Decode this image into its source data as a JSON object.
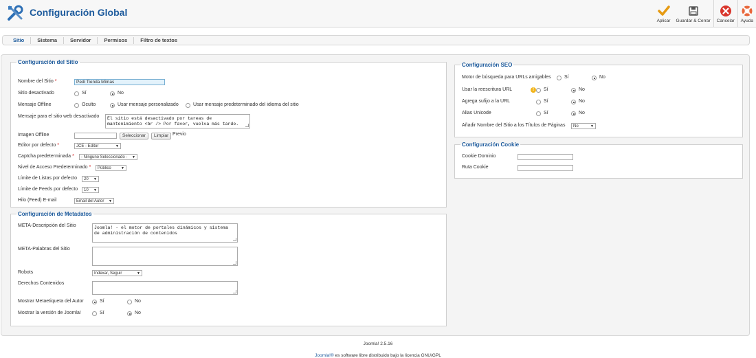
{
  "header": {
    "title": "Configuración Global",
    "icon": "tools-icon"
  },
  "toolbar": {
    "apply": "Aplicar",
    "save_close": "Guardar & Cerrar",
    "cancel": "Cancelar",
    "help": "Ayuda"
  },
  "tabs": [
    "Sitio",
    "Sistema",
    "Servidor",
    "Permisos",
    "Filtro de textos"
  ],
  "site": {
    "legend": "Configuración del Sitio",
    "site_name_label": "Nombre del Sitio",
    "site_name_value": "Pedi Tienda Mimas",
    "site_offline_label": "Sitio desactivado",
    "yes": "Sí",
    "no": "No",
    "offline_message_label": "Mensaje Offline",
    "hidden": "Oculto",
    "custom_message": "Usar mensaje personalizado",
    "default_message": "Usar mensaje predeterminado del idioma del sitio",
    "offline_text_label": "Mensaje para el sitio web desactivado",
    "offline_text_value": "El sitio está desactivado por tareas de mantenimiento <br /> Por favor, vuelva más tarde.",
    "offline_image_label": "Imagen Offline",
    "select_btn": "Seleccionar",
    "clear_btn": "Limpiar",
    "preview": "Previo",
    "editor_label": "Editor por defecto",
    "editor_value": "JCE - Editor",
    "captcha_label": "Captcha predeterminada",
    "captcha_value": "- Ninguno Seleccionado -",
    "access_label": "Nivel de Acceso Predeterminado",
    "access_value": "Público",
    "list_limit_label": "Límite de Listas por defecto",
    "list_limit_value": "20",
    "feed_limit_label": "Límite de Feeds por defecto",
    "feed_limit_value": "10",
    "feed_email_label": "Hilo (Feed) E-mail",
    "feed_email_value": "Email del Autor"
  },
  "metadata": {
    "legend": "Configuración de Metadatos",
    "desc_label": "META-Descripción del Sitio",
    "desc_value": "Joomla! - el motor de portales dinámicos y sistema de administración de contenidos",
    "keywords_label": "META-Palabras del Sitio",
    "robots_label": "Robots",
    "robots_value": "Indexar, Seguir",
    "rights_label": "Derechos Contenidos",
    "author_label": "Mostrar Metaetiqueta del Autor",
    "version_label": "Mostrar la versión de Joomla!",
    "yes": "Sí",
    "no": "No"
  },
  "seo": {
    "legend": "Configuración SEO",
    "sef_label": "Motor de búsqueda para URLs amigables",
    "rewrite_label": "Usar la reescritura URL",
    "suffix_label": "Agrega sufijo a la URL",
    "unicode_label": "Alias Unicode",
    "sitename_label": "Añadir Nombre del Sitio a los Títulos de Páginas",
    "sitename_value": "No",
    "yes": "Sí",
    "no": "No"
  },
  "cookie": {
    "legend": "Configuración Cookie",
    "domain_label": "Cookie Dominio",
    "path_label": "Ruta Cookie"
  },
  "footer": {
    "version": "Joomla! 2.5.16",
    "license_link": "Joomla!®",
    "license_text": " es software libre distribuido bajo la licencia GNU/GPL"
  }
}
